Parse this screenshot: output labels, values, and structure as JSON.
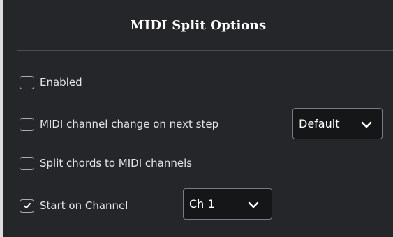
{
  "dialog": {
    "title": "MIDI Split Options"
  },
  "options": {
    "enabled": {
      "label": "Enabled",
      "checked": false
    },
    "channel_change": {
      "label": "MIDI channel change on next step",
      "checked": false,
      "dropdown_value": "Default"
    },
    "split_chords": {
      "label": "Split chords to MIDI channels",
      "checked": false
    },
    "start_channel": {
      "label": "Start on Channel",
      "checked": true,
      "dropdown_value": "Ch 1"
    }
  },
  "icons": {
    "checkmark": "check-icon",
    "chevron": "chevron-down-icon"
  },
  "colors": {
    "panel_bg": "#252629",
    "text": "#e4e4e4",
    "dropdown_bg": "#151618",
    "border": "#7a7b80"
  }
}
